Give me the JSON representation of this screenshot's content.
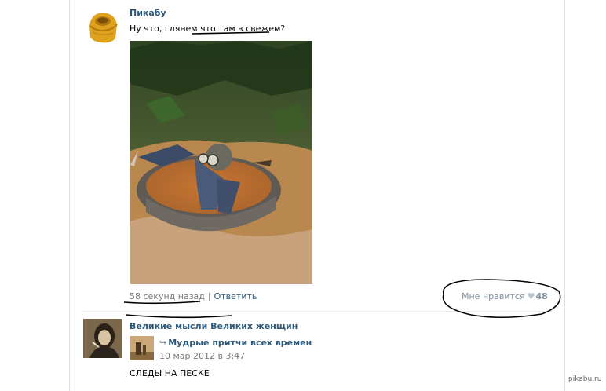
{
  "post": {
    "author": "Пикабу",
    "text": "Ну что, глянем что там в свежем?",
    "time": "58 секунд назад",
    "separator": "|",
    "reply_label": "Ответить",
    "like_label": "Мне нравится",
    "like_count": "48"
  },
  "repost_post": {
    "author": "Великие мысли Великих женщин",
    "repost_source": "Мудрые притчи всех времен",
    "repost_date": "10 мар 2012 в 3:47",
    "text": "СЛЕДЫ НА ПЕСКЕ"
  },
  "watermark": "pikabu.ru",
  "colors": {
    "link": "#2b587a",
    "muted": "#777777",
    "marker": "#000000"
  }
}
